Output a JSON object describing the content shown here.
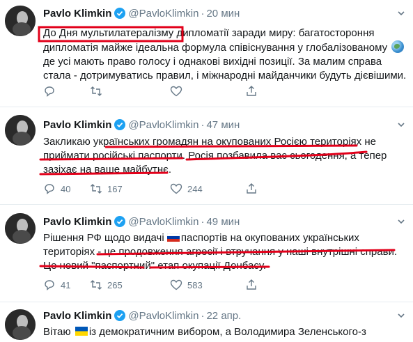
{
  "tweets": [
    {
      "name": "Pavlo Klimkin",
      "handle": "@PavloKlimkin",
      "separator": "·",
      "time": "20 мин",
      "lines": [
        "До Дня мультилатералізму",
        " дипломатії заради миру: багатостороння",
        "дипломатія майже ідеальна формула співіснування у глобалізованому ",
        "де усі мають право голосу і однакові вихідні позиції. За малим справа",
        "стала - дотримуватись правил, і міжнародні майданчики будуть дієвішими."
      ],
      "replies": "",
      "retweets": "",
      "likes": ""
    },
    {
      "name": "Pavlo Klimkin",
      "handle": "@PavloKlimkin",
      "separator": "·",
      "time": "47 мин",
      "lines": [
        "Закликаю українських громадян на окупованих Росією територіях не",
        "приймати російські паспорти. Росія позбавила вас сьогодення, а тепер",
        "зазіхає на ваше майбутнє."
      ],
      "replies": "40",
      "retweets": "167",
      "likes": "244"
    },
    {
      "name": "Pavlo Klimkin",
      "handle": "@PavloKlimkin",
      "separator": "·",
      "time": "49 мин",
      "lines": [
        "Рішення РФ щодо видачі ",
        "паспортів на окупованих українських",
        "територіях - це продовження агресії і втручання у наші внутрішні справи.",
        "Це новий \"паспортний\" етап окупації Донбасу."
      ],
      "replies": "41",
      "retweets": "265",
      "likes": "583"
    },
    {
      "name": "Pavlo Klimkin",
      "handle": "@PavloKlimkin",
      "separator": "·",
      "time": "22 апр.",
      "lines": [
        "Вітаю ",
        "із демократичним вибором, а Володимира Зеленського-з"
      ]
    }
  ],
  "icons": {
    "verified": "verified-badge-icon",
    "reply": "reply-icon",
    "retweet": "retweet-icon",
    "like": "heart-icon",
    "share": "share-icon",
    "chevron": "chevron-down-icon"
  },
  "colors": {
    "accent": "#1da1f2",
    "muted": "#657786",
    "annotation_red": "#e2001a"
  }
}
